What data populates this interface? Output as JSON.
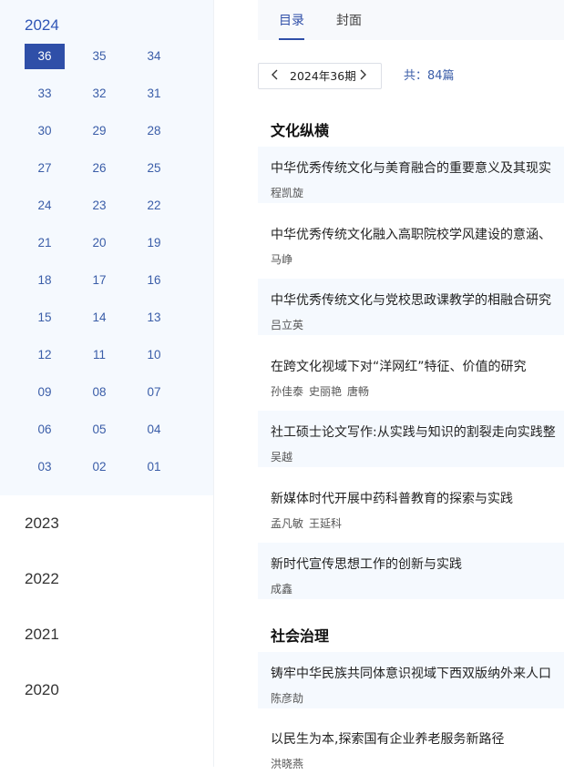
{
  "sidebar": {
    "active_year": "2024",
    "issues": [
      "36",
      "35",
      "34",
      "33",
      "32",
      "31",
      "30",
      "29",
      "28",
      "27",
      "26",
      "25",
      "24",
      "23",
      "22",
      "21",
      "20",
      "19",
      "18",
      "17",
      "16",
      "15",
      "14",
      "13",
      "12",
      "11",
      "10",
      "09",
      "08",
      "07",
      "06",
      "05",
      "04",
      "03",
      "02",
      "01"
    ],
    "active_issue": "36",
    "other_years": [
      "2023",
      "2022",
      "2021",
      "2020"
    ]
  },
  "tabs": [
    {
      "label": "目录",
      "active": true
    },
    {
      "label": "封面",
      "active": false
    }
  ],
  "pager": {
    "prev_icon": "chevron-left",
    "label": "2024年36期",
    "next_icon": "chevron-right"
  },
  "total": "共：84篇",
  "sections": [
    {
      "title": "文化纵横",
      "articles": [
        {
          "title": "中华优秀传统文化与美育融合的重要意义及其现实",
          "authors": [
            "程凯旋"
          ]
        },
        {
          "title": "中华优秀传统文化融入高职院校学风建设的意涵、",
          "authors": [
            "马峥"
          ]
        },
        {
          "title": "中华优秀传统文化与党校思政课教学的相融合研究",
          "authors": [
            "吕立英"
          ]
        },
        {
          "title": "在跨文化视域下对“洋网红”特征、价值的研究",
          "authors": [
            "孙佳泰",
            "史丽艳",
            "唐畅"
          ]
        },
        {
          "title": "社工硕士论文写作:从实践与知识的割裂走向实践整",
          "authors": [
            "吴越"
          ]
        },
        {
          "title": "新媒体时代开展中药科普教育的探索与实践",
          "authors": [
            "孟凡敏",
            "王延科"
          ]
        },
        {
          "title": "新时代宣传思想工作的创新与实践",
          "authors": [
            "成鑫"
          ]
        }
      ]
    },
    {
      "title": "社会治理",
      "articles": [
        {
          "title": "铸牢中华民族共同体意识视域下西双版纳外来人口",
          "authors": [
            "陈彦劼"
          ]
        },
        {
          "title": "以民生为本,探索国有企业养老服务新路径",
          "authors": [
            "洪晓燕"
          ]
        }
      ]
    }
  ]
}
